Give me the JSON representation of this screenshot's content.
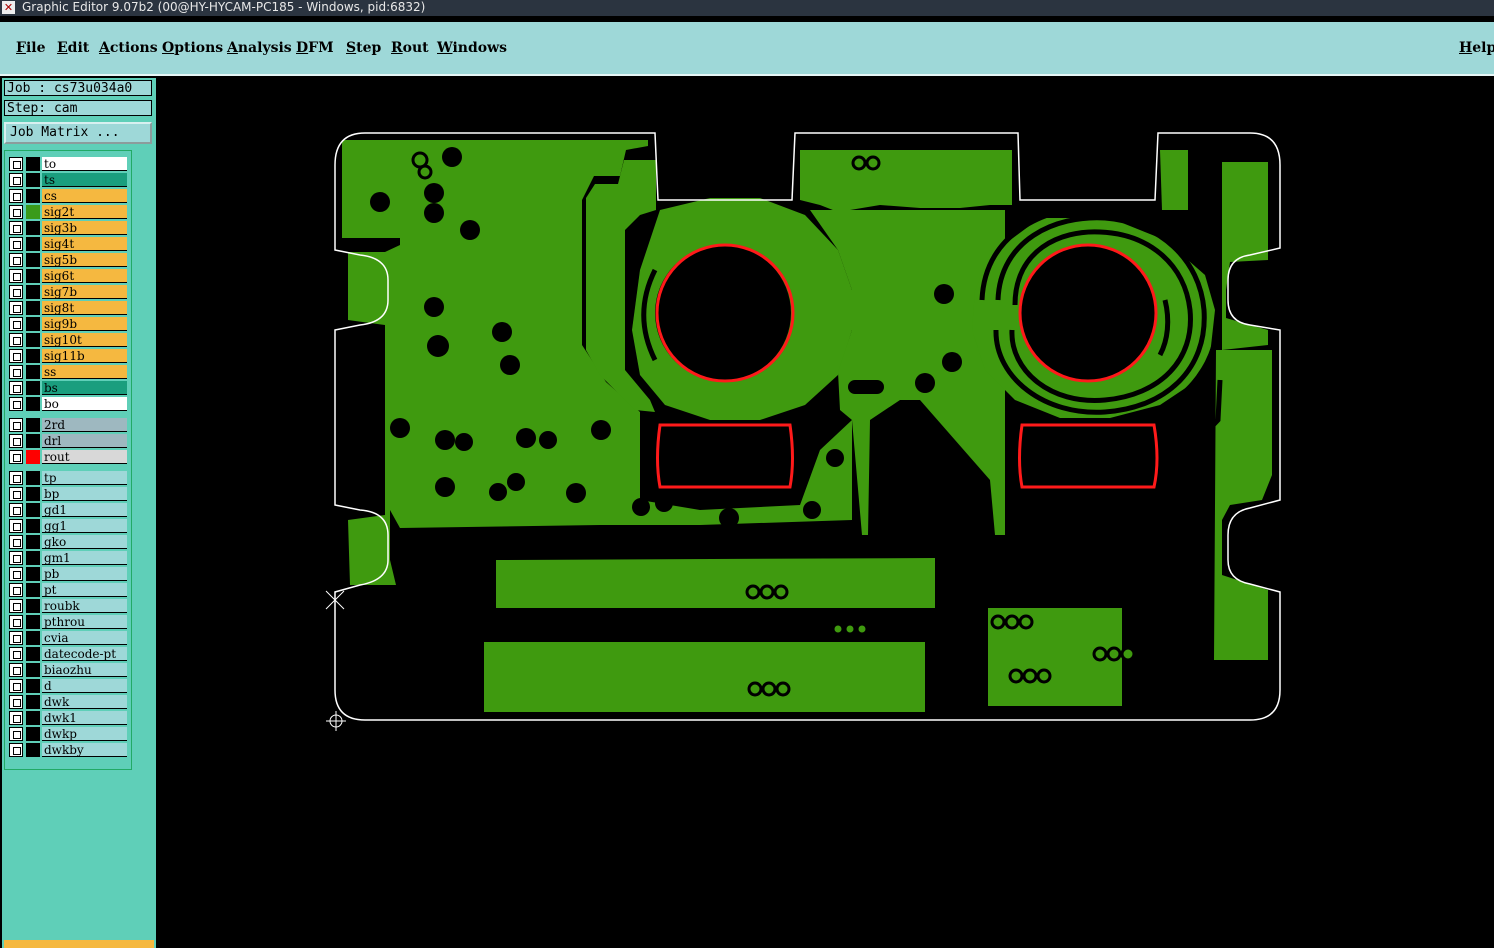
{
  "window": {
    "title": "Graphic Editor 9.07b2 (00@HY-HYCAM-PC185 - Windows, pid:6832)"
  },
  "menu": {
    "items": [
      "File",
      "Edit",
      "Actions",
      "Options",
      "Analysis",
      "DFM",
      "Step",
      "Rout",
      "Windows"
    ],
    "help": "Help"
  },
  "panel": {
    "job": "Job : cs73u034a0",
    "step": "Step: cam",
    "job_matrix": "Job Matrix ..."
  },
  "layers": [
    {
      "name": "to",
      "bg": "#ffffff",
      "sw": "#000000"
    },
    {
      "name": "ts",
      "bg": "#1a9e7e",
      "sw": "#000000"
    },
    {
      "name": "cs",
      "bg": "#f5b840",
      "sw": "#000000"
    },
    {
      "name": "sig2t",
      "bg": "#f5b840",
      "sw": "#3a9b1a"
    },
    {
      "name": "sig3b",
      "bg": "#f5b840",
      "sw": "#000000"
    },
    {
      "name": "sig4t",
      "bg": "#f5b840",
      "sw": "#000000"
    },
    {
      "name": "sig5b",
      "bg": "#f5b840",
      "sw": "#000000"
    },
    {
      "name": "sig6t",
      "bg": "#f5b840",
      "sw": "#000000"
    },
    {
      "name": "sig7b",
      "bg": "#f5b840",
      "sw": "#000000"
    },
    {
      "name": "sig8t",
      "bg": "#f5b840",
      "sw": "#000000"
    },
    {
      "name": "sig9b",
      "bg": "#f5b840",
      "sw": "#000000"
    },
    {
      "name": "sig10t",
      "bg": "#f5b840",
      "sw": "#000000"
    },
    {
      "name": "sig11b",
      "bg": "#f5b840",
      "sw": "#000000"
    },
    {
      "name": "ss",
      "bg": "#f5b840",
      "sw": "#000000"
    },
    {
      "name": "bs",
      "bg": "#1a9e7e",
      "sw": "#000000"
    },
    {
      "name": "bo",
      "bg": "#ffffff",
      "sw": "#000000"
    },
    {
      "name": "2rd",
      "bg": "#9eb8c0",
      "sw": "#000000"
    },
    {
      "name": "drl",
      "bg": "#9eb8c0",
      "sw": "#000000"
    },
    {
      "name": "rout",
      "bg": "#d8d8d8",
      "sw": "#ff0000"
    },
    {
      "name": "tp",
      "bg": "#9ed8d8",
      "sw": "#000000"
    },
    {
      "name": "bp",
      "bg": "#9ed8d8",
      "sw": "#000000"
    },
    {
      "name": "gd1",
      "bg": "#9ed8d8",
      "sw": "#000000"
    },
    {
      "name": "gg1",
      "bg": "#9ed8d8",
      "sw": "#000000"
    },
    {
      "name": "gko",
      "bg": "#9ed8d8",
      "sw": "#000000"
    },
    {
      "name": "gm1",
      "bg": "#9ed8d8",
      "sw": "#000000"
    },
    {
      "name": "pb",
      "bg": "#9ed8d8",
      "sw": "#000000"
    },
    {
      "name": "pt",
      "bg": "#9ed8d8",
      "sw": "#000000"
    },
    {
      "name": "roubk",
      "bg": "#9ed8d8",
      "sw": "#000000"
    },
    {
      "name": "pthrou",
      "bg": "#9ed8d8",
      "sw": "#000000"
    },
    {
      "name": "cvia",
      "bg": "#9ed8d8",
      "sw": "#000000"
    },
    {
      "name": "datecode-pt",
      "bg": "#9ed8d8",
      "sw": "#000000"
    },
    {
      "name": "biaozhu",
      "bg": "#9ed8d8",
      "sw": "#000000"
    },
    {
      "name": "d",
      "bg": "#9ed8d8",
      "sw": "#000000"
    },
    {
      "name": "dwk",
      "bg": "#9ed8d8",
      "sw": "#000000"
    },
    {
      "name": "dwk1",
      "bg": "#9ed8d8",
      "sw": "#000000"
    },
    {
      "name": "dwkp",
      "bg": "#9ed8d8",
      "sw": "#000000"
    },
    {
      "name": "dwkby",
      "bg": "#9ed8d8",
      "sw": "#000000"
    }
  ],
  "colors": {
    "copper": "#3f9a0f",
    "rout": "#ff1a1a",
    "outline": "#ffffff",
    "background": "#000000",
    "menu_bg": "#9ed8d8",
    "panel_bg": "#5fcfb8"
  },
  "icons": {
    "title_icon": "close-icon",
    "cursor": "crosshair-icon",
    "origin": "origin-marker-icon"
  }
}
